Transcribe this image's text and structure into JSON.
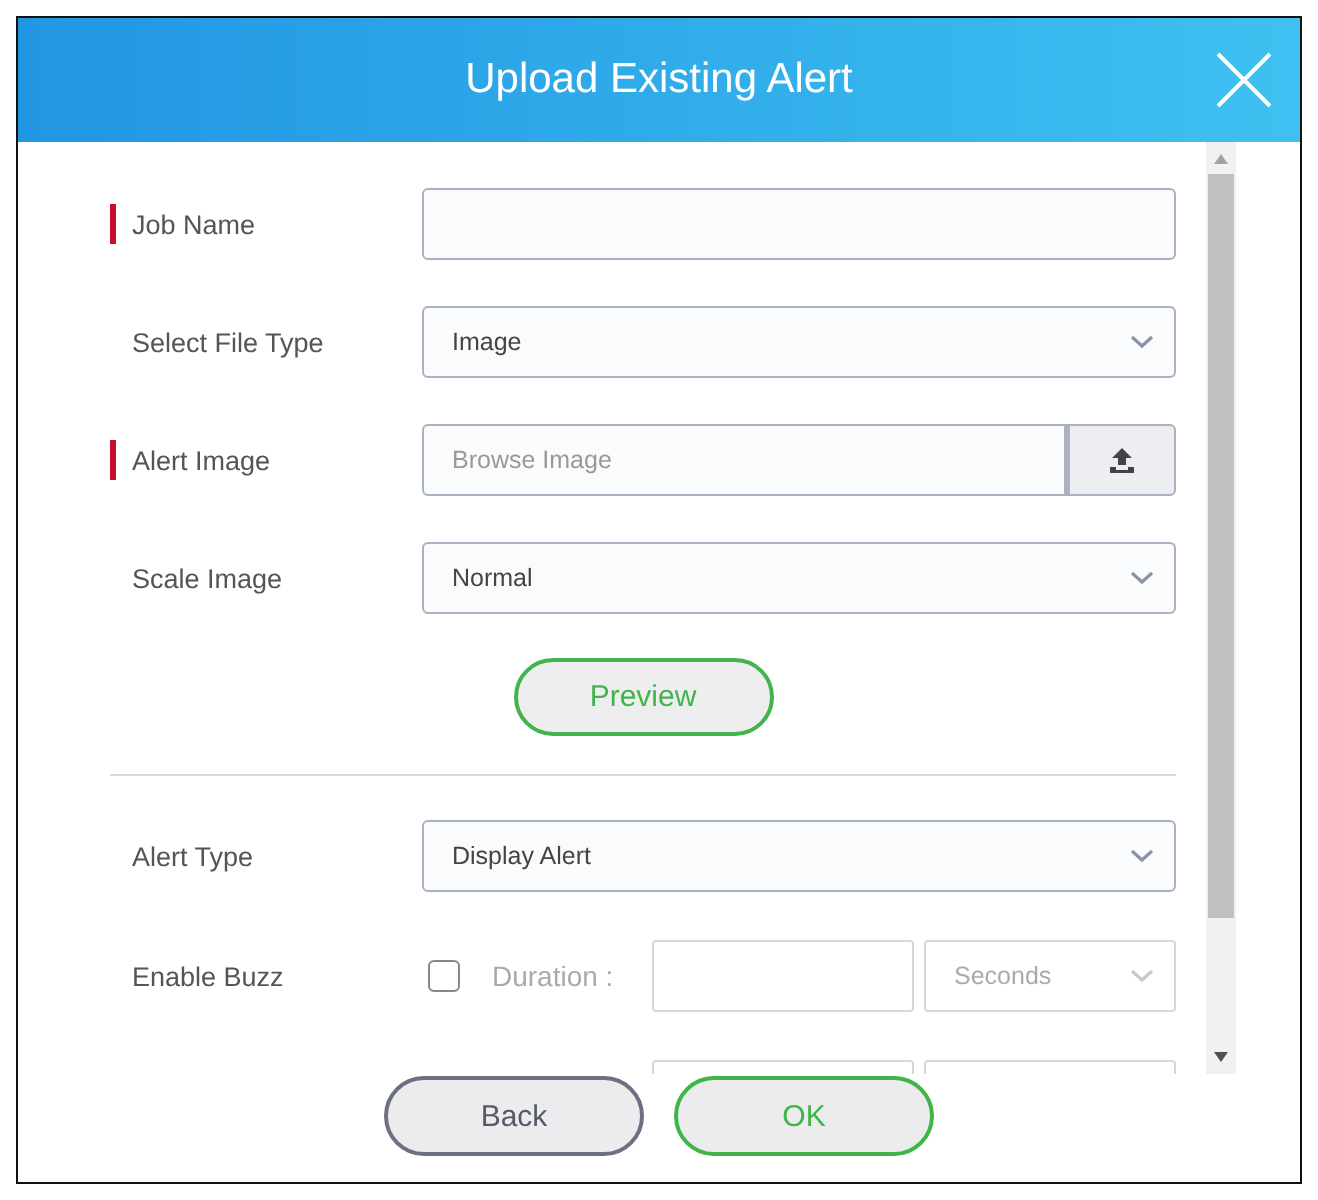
{
  "dialog": {
    "title": "Upload Existing Alert"
  },
  "fields": [
    {
      "kind": "text",
      "label": "Job Name",
      "required": true
    },
    {
      "kind": "select",
      "label": "Select File Type",
      "required": false,
      "value": "Image"
    },
    {
      "kind": "file",
      "label": "Alert Image",
      "required": true,
      "placeholder": "Browse Image"
    },
    {
      "kind": "select",
      "label": "Scale Image",
      "required": false,
      "value": "Normal"
    }
  ],
  "preview_button": "Preview",
  "fields_after": [
    {
      "kind": "select",
      "label": "Alert Type",
      "required": false,
      "value": "Display Alert"
    },
    {
      "kind": "buzz",
      "label": "Enable Buzz",
      "required": false,
      "checked": false,
      "duration_label": "Duration :",
      "disabled": true,
      "unit": "Seconds"
    }
  ],
  "hidden_row": [
    {
      "kind": "input"
    },
    {
      "kind": "select"
    }
  ],
  "buttons": [
    {
      "label": "Back",
      "kind": "secondary"
    },
    {
      "label": "OK",
      "kind": "primary"
    }
  ]
}
